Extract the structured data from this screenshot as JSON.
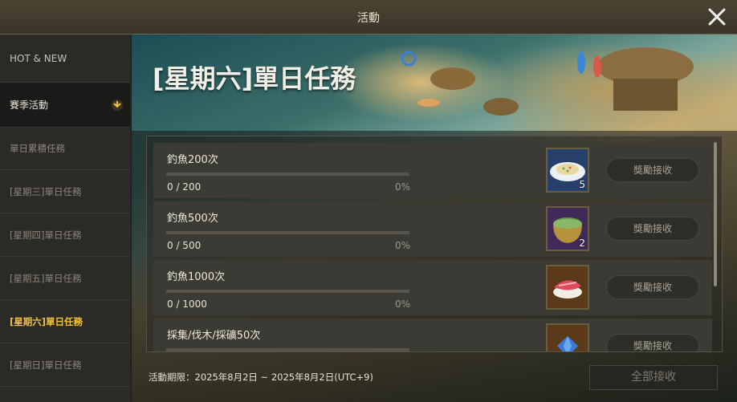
{
  "window": {
    "title": "活動"
  },
  "sidebar": {
    "items": [
      {
        "label": "HOT & NEW"
      },
      {
        "label": "賽季活動"
      },
      {
        "label": "單日累積任務"
      },
      {
        "label": "[星期三]單日任務"
      },
      {
        "label": "[星期四]單日任務"
      },
      {
        "label": "[星期五]單日任務"
      },
      {
        "label": "[星期六]單日任務"
      },
      {
        "label": "[星期日]單日任務"
      }
    ]
  },
  "main": {
    "title": "[星期六]單日任務",
    "quests": [
      {
        "name": "釣魚200次",
        "progress": "0 / 200",
        "percent": "0%",
        "progress_value": 0,
        "reward_count": "5",
        "reward_icon": "fried-rice-plate-icon",
        "claim_label": "獎勵接收"
      },
      {
        "name": "釣魚500次",
        "progress": "0 / 500",
        "percent": "0%",
        "progress_value": 0,
        "reward_count": "2",
        "reward_icon": "stew-pot-icon",
        "claim_label": "獎勵接收"
      },
      {
        "name": "釣魚1000次",
        "progress": "0 / 1000",
        "percent": "0%",
        "progress_value": 0,
        "reward_count": "",
        "reward_icon": "tuna-sushi-icon",
        "claim_label": "獎勵接收"
      },
      {
        "name": "採集/伐木/採礦50次",
        "progress": "",
        "percent": "",
        "progress_value": 0,
        "reward_count": "",
        "reward_icon": "blue-gem-icon",
        "claim_label": "獎勵接收"
      }
    ],
    "period": "活動期限：2025年8月2日 ~ 2025年8月2日(UTC+9)",
    "claim_all_label": "全部接收"
  },
  "colors": {
    "accent": "#f4c23a",
    "panel": "#3b3a35",
    "sidebar": "#2b2a27"
  }
}
